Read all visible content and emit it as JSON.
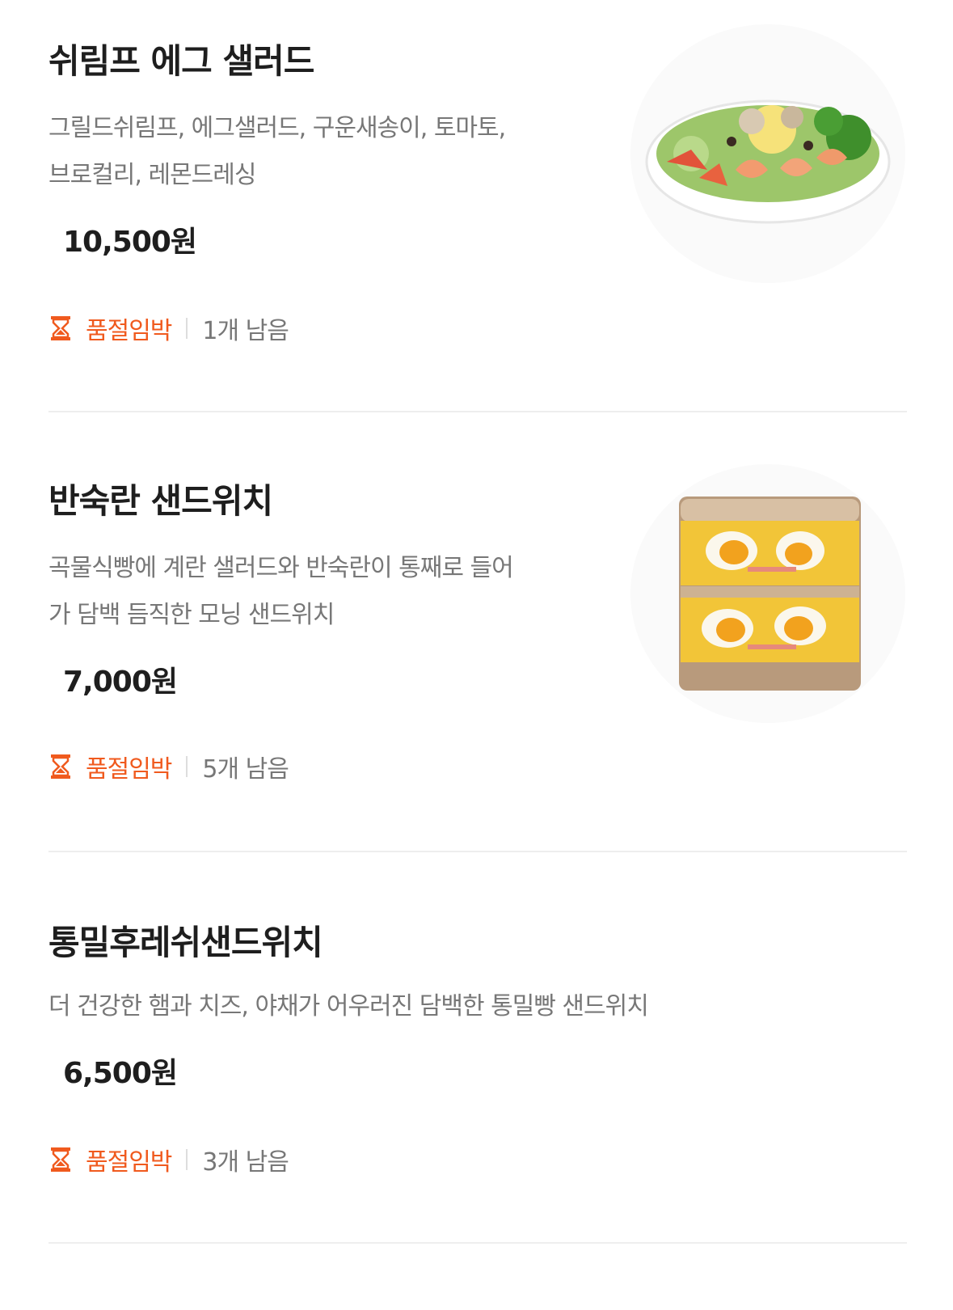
{
  "items": [
    {
      "name": "쉬림프 에그 샐러드",
      "desc_line1": "그릴드쉬림프, 에그샐러드, 구운새송이, 토마토,",
      "desc_line2": "브로컬리, 레몬드레싱",
      "price": "10,500원",
      "stock_label": "품절임박",
      "stock_count": "1개 남음",
      "image_icon": "salad-bowl"
    },
    {
      "name": "반숙란 샌드위치",
      "desc_line1": "곡물식빵에 계란 샐러드와 반숙란이 통째로 들어",
      "desc_line2": "가 담백 듬직한 모닝 샌드위치",
      "price": "7,000원",
      "stock_label": "품절임박",
      "stock_count": "5개 남음",
      "image_icon": "egg-sandwich"
    },
    {
      "name": "통밀후레쉬샌드위치",
      "desc_line1": "더 건강한 햄과 치즈, 야채가 어우러진 담백한 통밀빵 샌드위치",
      "desc_line2": "",
      "price": "6,500원",
      "stock_label": "품절임박",
      "stock_count": "3개 남음",
      "image_icon": ""
    }
  ],
  "colors": {
    "accent": "#f05a1e",
    "text_primary": "#1e1e1e",
    "text_secondary": "#777777",
    "divider": "#eeeeee"
  }
}
